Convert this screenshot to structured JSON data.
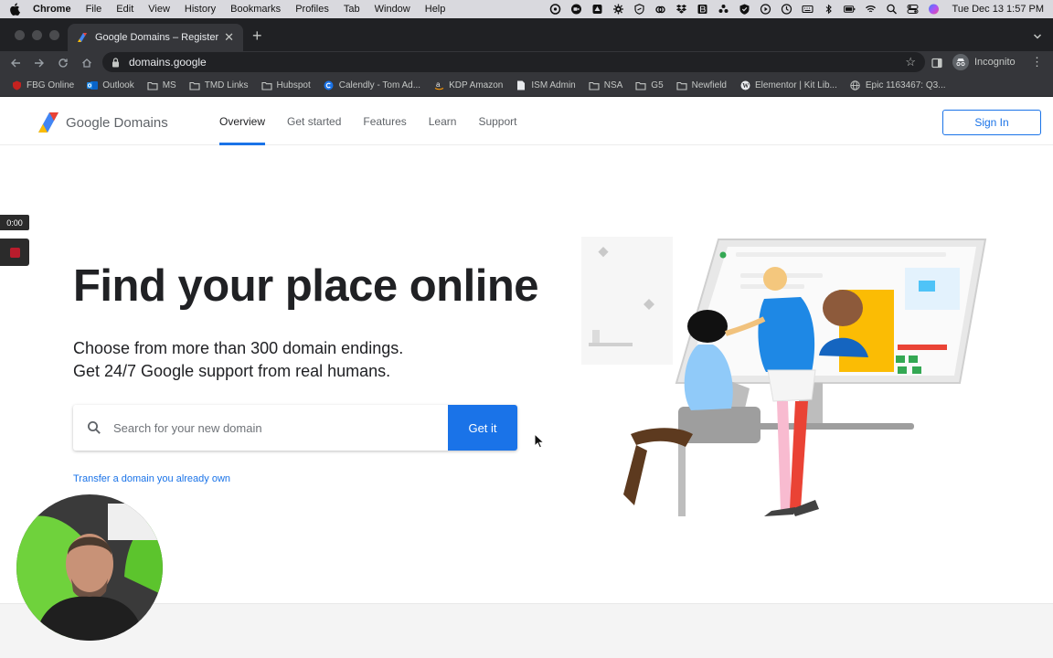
{
  "menubar": {
    "app": "Chrome",
    "items": [
      "File",
      "Edit",
      "View",
      "History",
      "Bookmarks",
      "Profiles",
      "Tab",
      "Window",
      "Help"
    ],
    "clock": "Tue Dec 13  1:57 PM"
  },
  "browser": {
    "tab_title": "Google Domains – Register Yo",
    "url": "domains.google",
    "profile_label": "Incognito"
  },
  "bookmarks": [
    {
      "label": "FBG Online",
      "icon": "fbg-icon"
    },
    {
      "label": "Outlook",
      "icon": "outlook-icon"
    },
    {
      "label": "MS",
      "icon": "folder-icon"
    },
    {
      "label": "TMD Links",
      "icon": "folder-icon"
    },
    {
      "label": "Hubspot",
      "icon": "folder-icon"
    },
    {
      "label": "Calendly - Tom Ad...",
      "icon": "calendly-icon"
    },
    {
      "label": "KDP Amazon",
      "icon": "amazon-icon"
    },
    {
      "label": "ISM Admin",
      "icon": "doc-icon"
    },
    {
      "label": "NSA",
      "icon": "folder-icon"
    },
    {
      "label": "G5",
      "icon": "folder-icon"
    },
    {
      "label": "Newfield",
      "icon": "folder-icon"
    },
    {
      "label": "Elementor | Kit Lib...",
      "icon": "wordpress-icon"
    },
    {
      "label": "Epic 1163467: Q3...",
      "icon": "globe-icon"
    }
  ],
  "site": {
    "logo_text": "Google Domains",
    "nav": [
      {
        "label": "Overview",
        "active": true
      },
      {
        "label": "Get started",
        "active": false
      },
      {
        "label": "Features",
        "active": false
      },
      {
        "label": "Learn",
        "active": false
      },
      {
        "label": "Support",
        "active": false
      }
    ],
    "sign_in": "Sign In",
    "hero_title": "Find your place online",
    "hero_sub_line1": "Choose from more than 300 domain endings.",
    "hero_sub_line2": "Get 24/7 Google support from real humans.",
    "search_placeholder": "Search for your new domain",
    "search_button": "Get it",
    "transfer_link": "Transfer a domain you already own"
  },
  "recorder": {
    "timer": "0:00"
  },
  "colors": {
    "accent": "#1a73e8",
    "text": "#202124",
    "muted": "#5f6368"
  }
}
